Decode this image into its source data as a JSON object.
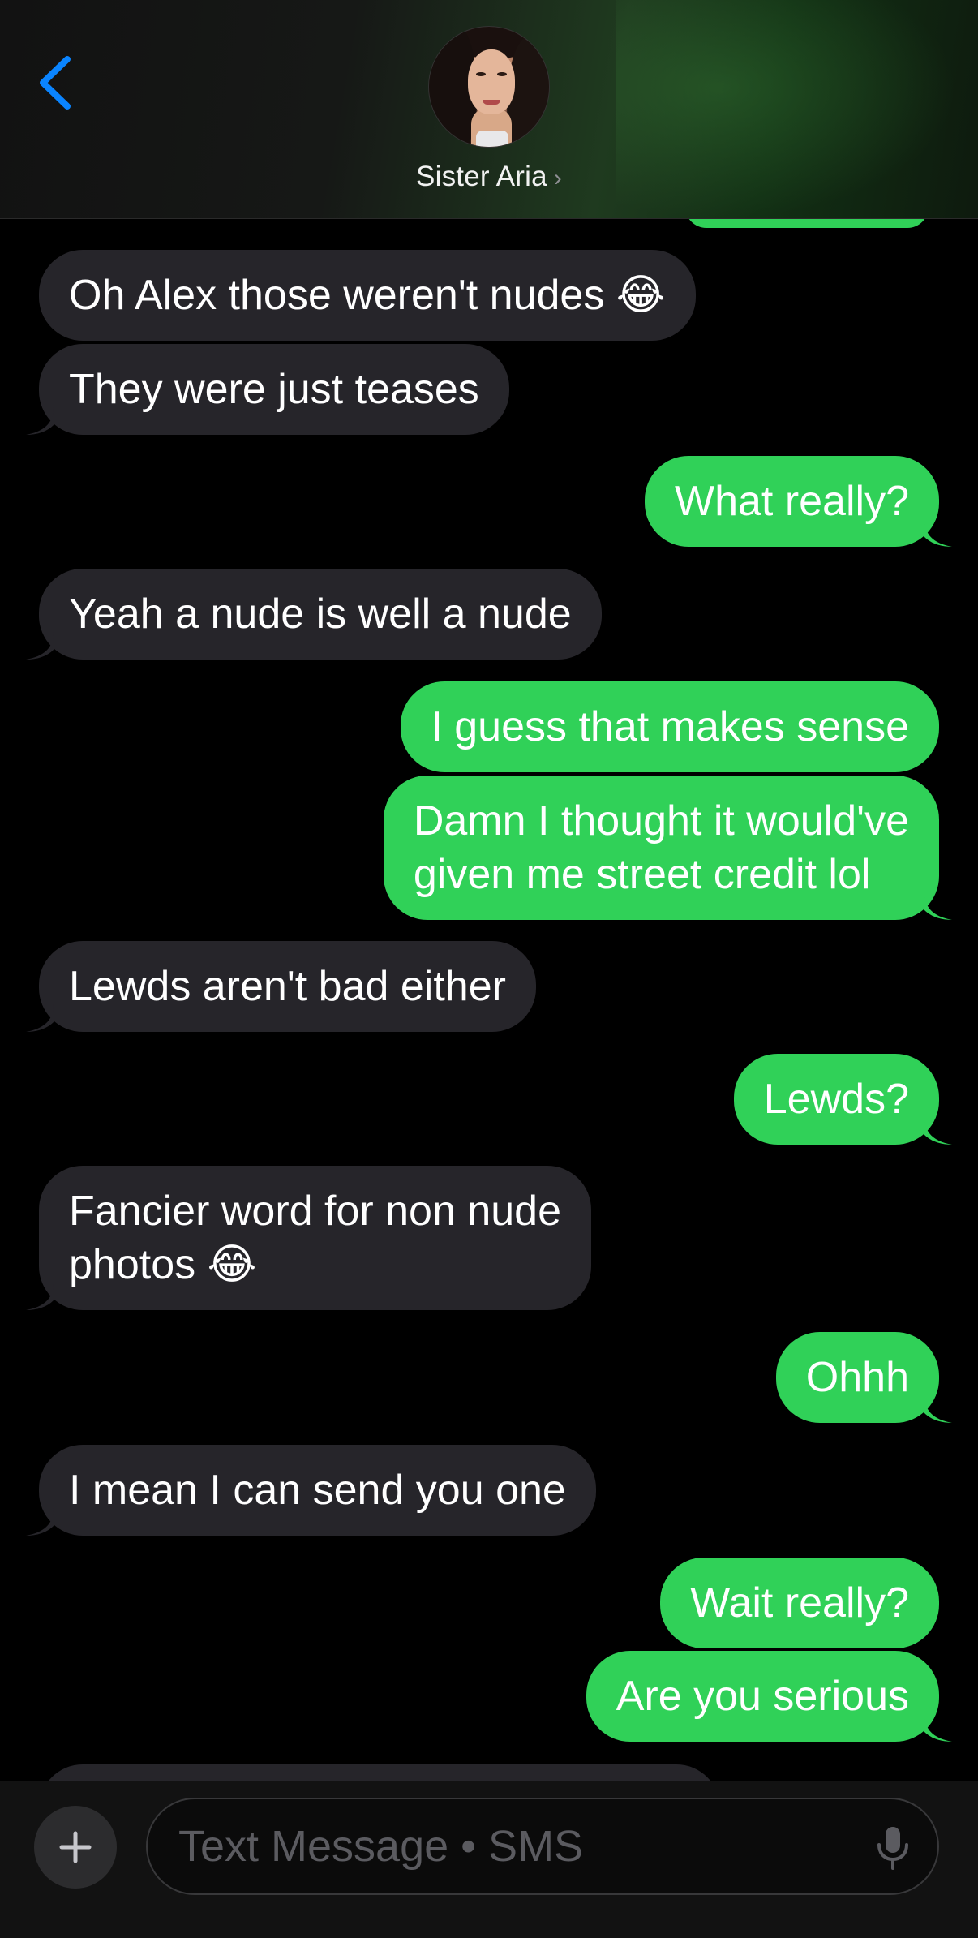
{
  "header": {
    "back_icon": "chevron-left-icon",
    "contact_name": "Sister Aria",
    "contact_chevron": "›",
    "accent_color": "#0a84ff"
  },
  "messages": [
    {
      "side": "in",
      "text": "Oh Alex those weren't nudes 😂",
      "tail": false
    },
    {
      "side": "in",
      "text": "They were just teases",
      "tail": true
    },
    {
      "side": "out",
      "text": "What really?",
      "tail": true
    },
    {
      "side": "in",
      "text": "Yeah a nude is well a nude",
      "tail": true
    },
    {
      "side": "out",
      "text": "I guess that makes sense",
      "tail": false
    },
    {
      "side": "out",
      "text": "Damn I thought it would've\ngiven me street credit lol",
      "tail": true
    },
    {
      "side": "in",
      "text": "Lewds aren't bad either",
      "tail": true
    },
    {
      "side": "out",
      "text": "Lewds?",
      "tail": true
    },
    {
      "side": "in",
      "text": "Fancier word for non nude\nphotos 😂",
      "tail": true
    },
    {
      "side": "out",
      "text": "Ohhh",
      "tail": true
    },
    {
      "side": "in",
      "text": "I mean I can send you one",
      "tail": true
    },
    {
      "side": "out",
      "text": "Wait really?",
      "tail": false
    },
    {
      "side": "out",
      "text": "Are you serious",
      "tail": true
    }
  ],
  "composer": {
    "plus_icon": "plus-icon",
    "placeholder": "Text Message • SMS",
    "value": "",
    "mic_icon": "microphone-icon"
  },
  "colors": {
    "incoming_bubble": "#26252a",
    "outgoing_bubble": "#30d158",
    "background": "#000000"
  }
}
